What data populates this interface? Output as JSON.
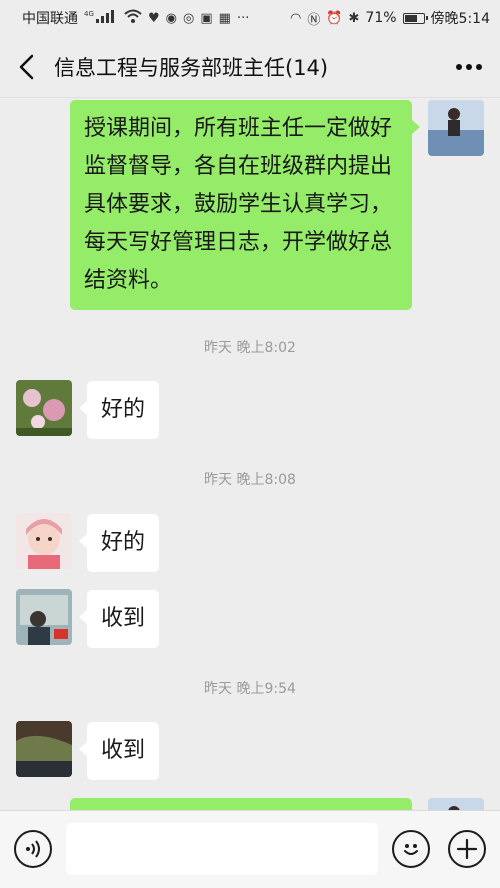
{
  "status_bar": {
    "carrier": "中国联通",
    "network": "4G",
    "battery_text": "71%",
    "battery_level": 0.71,
    "time": "傍晚5:14"
  },
  "header": {
    "title": "信息工程与服务部班主任(14)"
  },
  "messages": {
    "m1_text": "授课期间，所有班主任一定做好监督督导，各自在班级群内提出具体要求，鼓励学生认真学习，每天写好管理日志，开学做好总结资料。",
    "ts1": "昨天 晚上8:02",
    "m2_text": "好的",
    "ts2": "昨天 晚上8:08",
    "m3_text": "好的",
    "m4_text": "收到",
    "ts3": "昨天 晚上9:54",
    "m5_text": "收到"
  },
  "colors": {
    "outgoing_bubble": "#95ec69",
    "incoming_bubble": "#ffffff",
    "background": "#ededed"
  },
  "icons": {
    "back": "chevron-left-icon",
    "more": "ellipsis-icon",
    "voice": "voice-icon",
    "emoji": "emoji-icon",
    "add": "plus-icon"
  }
}
